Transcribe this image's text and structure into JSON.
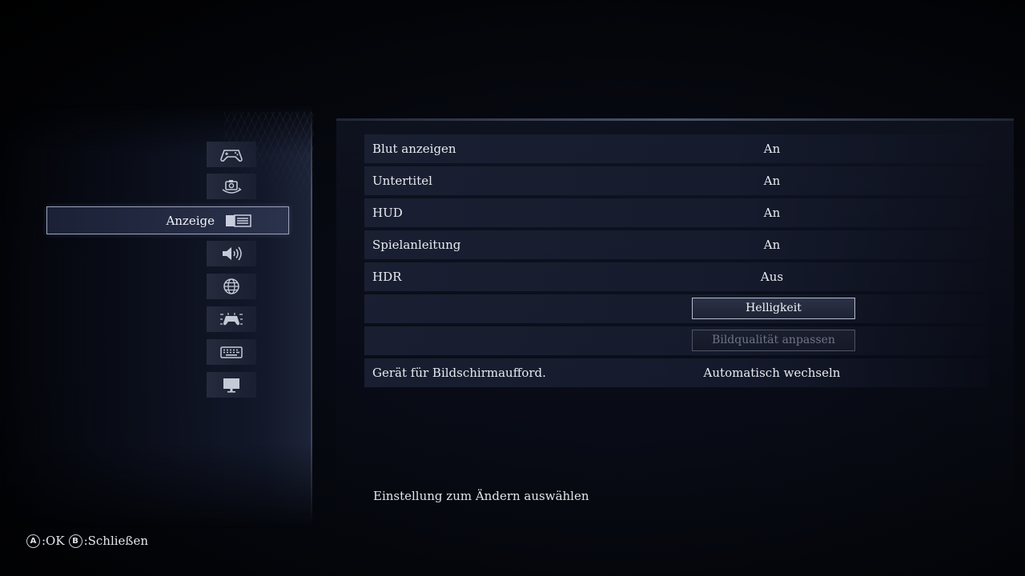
{
  "sidebar": {
    "categories": [
      {
        "id": "gameplay",
        "icon": "gamepad-icon"
      },
      {
        "id": "camera",
        "icon": "camera-rotate-icon"
      },
      {
        "id": "display",
        "icon": "display-settings-icon",
        "label": "Anzeige",
        "active": true
      },
      {
        "id": "audio",
        "icon": "speaker-icon"
      },
      {
        "id": "language",
        "icon": "globe-icon"
      },
      {
        "id": "controller",
        "icon": "controller-layout-icon"
      },
      {
        "id": "keyboard",
        "icon": "keyboard-icon"
      },
      {
        "id": "monitor",
        "icon": "monitor-icon"
      }
    ],
    "active_label": "Anzeige"
  },
  "settings": {
    "rows": [
      {
        "label": "Blut anzeigen",
        "value": "An"
      },
      {
        "label": "Untertitel",
        "value": "An"
      },
      {
        "label": "HUD",
        "value": "An"
      },
      {
        "label": "Spielanleitung",
        "value": "An"
      },
      {
        "label": "HDR",
        "value": "Aus"
      },
      {
        "button": "Helligkeit"
      },
      {
        "button": "Bildqualität anpassen",
        "disabled": true
      },
      {
        "label": "Gerät für Bildschirmaufford.",
        "value": "Automatisch wechseln"
      }
    ]
  },
  "hint": "Einstellung zum Ändern auswählen",
  "footer": {
    "a_glyph": "A",
    "a_label": ":OK",
    "b_glyph": "B",
    "b_label": ":Schließen"
  },
  "colors": {
    "background": "#000000",
    "panel": "#1c2236",
    "text": "#e8eaf0",
    "disabled_text": "#6e7488",
    "highlight_border": "#9aa2bc"
  }
}
